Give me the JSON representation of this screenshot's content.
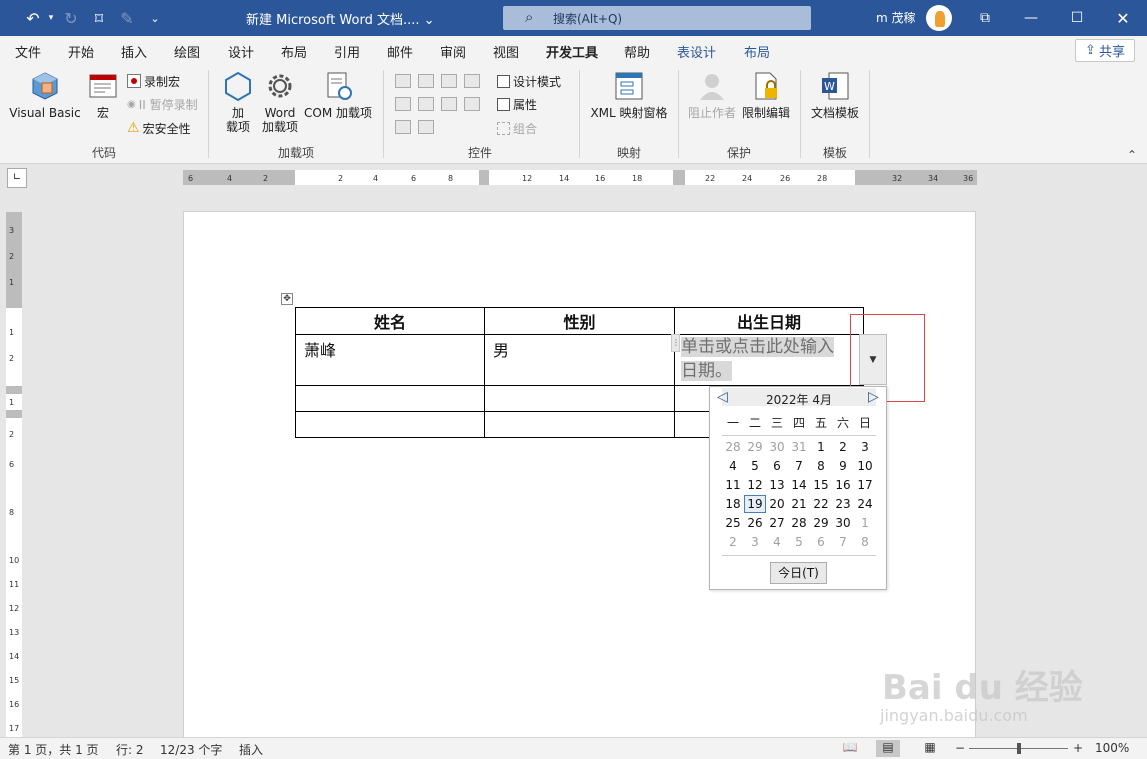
{
  "titlebar": {
    "undo_icon": "undo-icon",
    "redo_icon": "redo-icon",
    "doc_title": "新建 Microsoft Word 文档.... ⌄",
    "search_placeholder": "搜索(Alt+Q)",
    "user_name": "m 茂稼",
    "bg_color": "#2b579a"
  },
  "tabs": [
    "文件",
    "开始",
    "插入",
    "绘图",
    "设计",
    "布局",
    "引用",
    "邮件",
    "审阅",
    "视图",
    "开发工具",
    "帮助",
    "表设计",
    "布局"
  ],
  "active_tab": "开发工具",
  "share_label": "共享",
  "ribbon": {
    "code": {
      "label": "代码",
      "visual_basic": "Visual Basic",
      "macro": "宏",
      "record_macro": "录制宏",
      "pause_record": "II 暂停录制",
      "macro_security": "宏安全性"
    },
    "addins": {
      "label": "加载项",
      "addin_line1": "加",
      "addin_line2": "载项",
      "word_line1": "Word",
      "word_line2": "加载项",
      "com": "COM 加载项"
    },
    "controls": {
      "label": "控件",
      "design_mode": "设计模式",
      "properties": "属性",
      "group": "组合"
    },
    "mapping": {
      "label": "映射",
      "xml_pane": "XML 映射窗格"
    },
    "protect": {
      "label": "保护",
      "block_authors": "阻止作者",
      "restrict_editing": "限制编辑"
    },
    "templates": {
      "label": "模板",
      "doc_template": "文档模板"
    }
  },
  "hruler_ticks": [
    "6",
    "4",
    "2",
    "2",
    "4",
    "6",
    "8",
    "12",
    "14",
    "16",
    "18",
    "22",
    "24",
    "26",
    "28",
    "32",
    "34",
    "36"
  ],
  "vruler_ticks": [
    "3",
    "2",
    "1",
    "1",
    "2",
    "1",
    "2",
    "6",
    "8",
    "10",
    "11",
    "12",
    "13",
    "14",
    "15",
    "16",
    "17"
  ],
  "table": {
    "headers": [
      "姓名",
      "性别",
      "出生日期"
    ],
    "row1": [
      "萧峰",
      "男"
    ]
  },
  "date_control": {
    "placeholder_line1": "单击或点击此处输入",
    "placeholder_line2": "日期。"
  },
  "calendar": {
    "month_title": "2022年 4月",
    "weekdays": [
      "一",
      "二",
      "三",
      "四",
      "五",
      "六",
      "日"
    ],
    "weeks": [
      [
        "28",
        "29",
        "30",
        "31",
        "1",
        "2",
        "3"
      ],
      [
        "4",
        "5",
        "6",
        "7",
        "8",
        "9",
        "10"
      ],
      [
        "11",
        "12",
        "13",
        "14",
        "15",
        "16",
        "17"
      ],
      [
        "18",
        "19",
        "20",
        "21",
        "22",
        "23",
        "24"
      ],
      [
        "25",
        "26",
        "27",
        "28",
        "29",
        "30",
        "1"
      ],
      [
        "2",
        "3",
        "4",
        "5",
        "6",
        "7",
        "8"
      ]
    ],
    "selected_day": "19",
    "today_label": "今日(T)"
  },
  "status": {
    "page": "第 1 页，共 1 页",
    "row": "行: 2",
    "words": "12/23 个字",
    "mode": "插入",
    "zoom": "100%",
    "zoom_minus": "−",
    "zoom_plus": "+"
  },
  "watermark": {
    "line1": "Bai du 经验",
    "line2": "jingyan.baidu.com"
  },
  "colors": {
    "accent": "#2b579a",
    "highlight_box": "#e0454b"
  }
}
